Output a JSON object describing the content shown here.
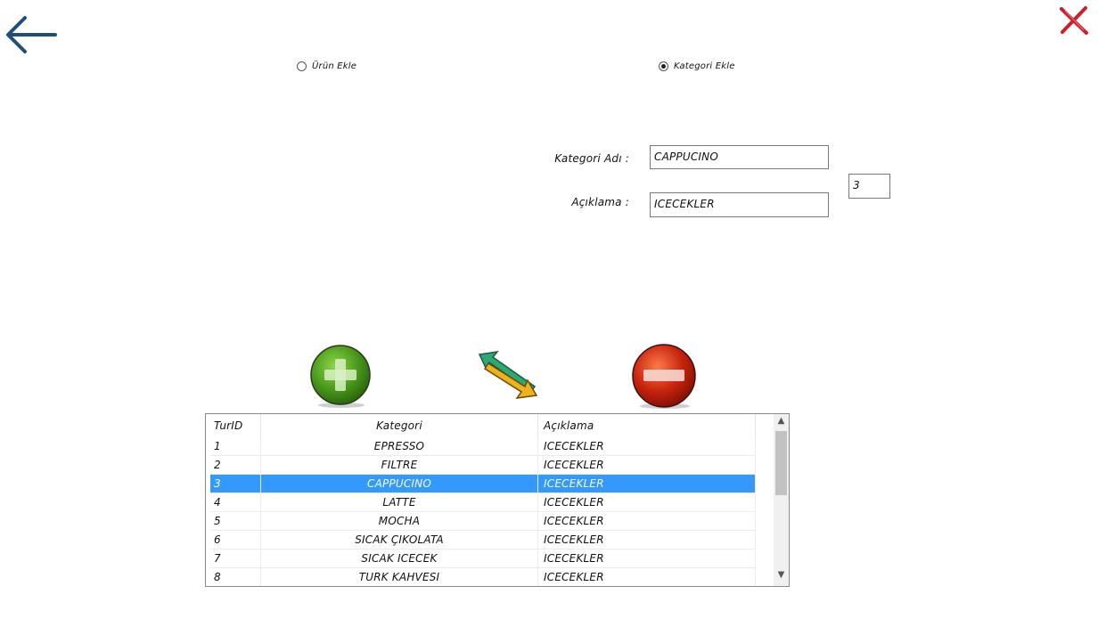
{
  "nav": {
    "back_icon": "arrow-left-icon",
    "close_icon": "close-x-icon"
  },
  "mode": {
    "urun_ekle_label": "Ürün Ekle",
    "urun_ekle_selected": false,
    "kategori_ekle_label": "Kategori Ekle",
    "kategori_ekle_selected": true
  },
  "form": {
    "kategori_adi_label": "Kategori Adı :",
    "kategori_adi_value": "CAPPUCINO",
    "aciklama_label": "Açıklama :",
    "aciklama_value": "ICECEKLER",
    "id_value": "3"
  },
  "actions": {
    "add_icon": "green-plus-icon",
    "update_icon": "swap-arrows-icon",
    "delete_icon": "red-minus-icon"
  },
  "grid": {
    "columns": [
      "TurID",
      "Kategori",
      "Açıklama"
    ],
    "selected_index": 2,
    "rows": [
      [
        "1",
        "EPRESSO",
        "ICECEKLER"
      ],
      [
        "2",
        "FILTRE",
        "ICECEKLER"
      ],
      [
        "3",
        "CAPPUCINO",
        "ICECEKLER"
      ],
      [
        "4",
        "LATTE",
        "ICECEKLER"
      ],
      [
        "5",
        "MOCHA",
        "ICECEKLER"
      ],
      [
        "6",
        "SICAK ÇIKOLATA",
        "ICECEKLER"
      ],
      [
        "7",
        "SICAK ICECEK",
        "ICECEKLER"
      ],
      [
        "8",
        "TURK KAHVESI",
        "ICECEKLER"
      ]
    ]
  },
  "colors": {
    "selection": "#3399ff",
    "back_arrow": "#1f4e79",
    "close_x": "#cc1f2a",
    "add_green": "#4a9a1c",
    "delete_red": "#c8250e"
  }
}
